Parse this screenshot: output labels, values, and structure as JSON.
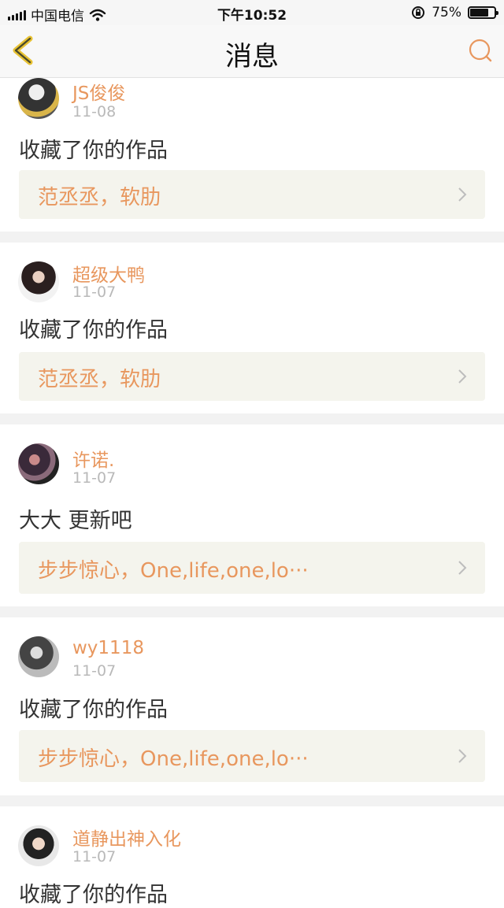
{
  "status": {
    "carrier": "中国电信",
    "time": "下午10:52",
    "battery": "75%",
    "battery_level": 0.75
  },
  "nav": {
    "title": "消息"
  },
  "messages": [
    {
      "user": "JS俊俊",
      "date": "11-08",
      "text": "收藏了你的作品",
      "work": "范丞丞，软肋"
    },
    {
      "user": "超级大鸭",
      "date": "11-07",
      "text": "收藏了你的作品",
      "work": "范丞丞，软肋"
    },
    {
      "user": "许诺.",
      "date": "11-07",
      "text": "大大 更新吧",
      "work": "步步惊心，One,life,one,lo···"
    },
    {
      "user": "wy1118",
      "date": "11-07",
      "text": "收藏了你的作品",
      "work": "步步惊心，One,life,one,lo···"
    },
    {
      "user": "道静出神入化",
      "date": "11-07",
      "text": "收藏了你的作品"
    }
  ],
  "colors": {
    "accent": "#e8975e",
    "card_bg": "#f4f4ed",
    "separator": "#f2f2f2"
  }
}
